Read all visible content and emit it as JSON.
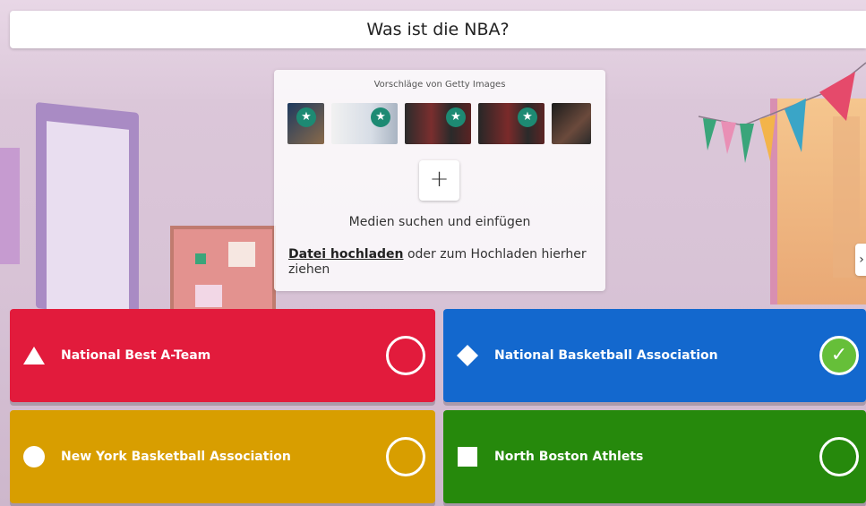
{
  "question": {
    "title": "Was ist die NBA?"
  },
  "media_panel": {
    "getty_caption": "Vorschläge von Getty Images",
    "add_symbol": "+",
    "search_label": "Medien suchen und einfügen",
    "upload_link": "Datei hochladen",
    "upload_suffix": "oder zum Hochladen hierher ziehen"
  },
  "side_toggle": {
    "glyph": "›"
  },
  "answers": [
    {
      "label": "National Best A-Team",
      "shape": "triangle-icon",
      "color": "#e21b3c",
      "correct": false
    },
    {
      "label": "National Basketball Association",
      "shape": "diamond-icon",
      "color": "#1368ce",
      "correct": true
    },
    {
      "label": "New York Basketball Association",
      "shape": "circle-icon",
      "color": "#d89e00",
      "correct": false
    },
    {
      "label": "North Boston Athlets",
      "shape": "square-icon",
      "color": "#26890c",
      "correct": false
    }
  ],
  "correct_mark": "✓"
}
